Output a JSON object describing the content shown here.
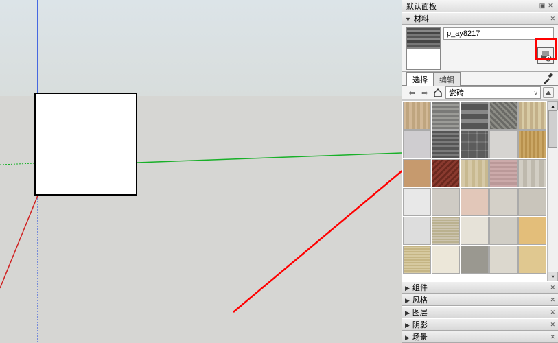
{
  "panel": {
    "title": "默认面板",
    "sections": {
      "materials": "材料",
      "components": "组件",
      "styles": "风格",
      "layers": "图层",
      "shadows": "阴影",
      "scenes": "场景"
    }
  },
  "materials": {
    "current_name": "p_ay8217",
    "tabs": {
      "select": "选择",
      "edit": "编辑"
    },
    "library_dropdown": "瓷砖",
    "icons": {
      "create": "create-material-icon",
      "default": "default-material-icon",
      "eyedropper": "eyedropper-icon",
      "back": "nav-back-icon",
      "forward": "nav-forward-icon",
      "home": "home-icon",
      "details": "details-icon"
    },
    "thumbnails": [
      "t1",
      "t2",
      "t3",
      "t4",
      "t5",
      "t6",
      "t7",
      "t8",
      "t9",
      "t10",
      "t11",
      "t12",
      "t13",
      "t14",
      "t15",
      "t16",
      "t17",
      "t18",
      "t19",
      "t20",
      "t21",
      "t22",
      "t23",
      "t24",
      "t25",
      "t26",
      "t27",
      "t28",
      "t29",
      "t30"
    ]
  },
  "axes": {
    "blue": "#1030d0",
    "green": "#10a020",
    "red": "#c01010"
  },
  "annotation": {
    "color": "#ff0000"
  }
}
